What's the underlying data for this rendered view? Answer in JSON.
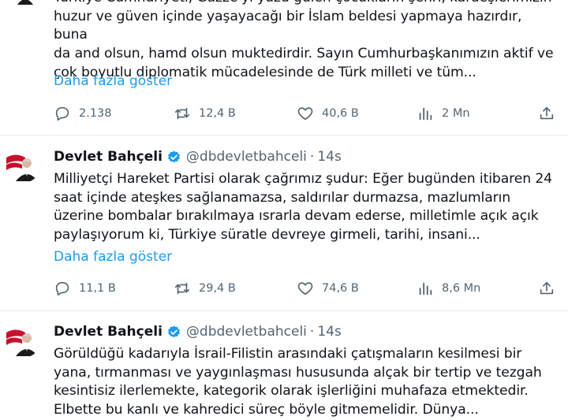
{
  "tweets": [
    {
      "text": "Türkiye Cumhuriyeti, Gazze'yi yüzü gülen çocukların şehri, kardeşlerimizin\nhuzur ve güven içinde yaşayacağı bir İslam beldesi yapmaya hazırdır, buna\nda and olsun, hamd olsun muktedirdir. Sayın Cumhurbaşkanımızın aktif ve\nçok boyutlu diplomatik mücadelesinde de Türk milleti ve tüm...",
      "more": "Daha fazla göster",
      "replies": "2.138",
      "retweets": "12,4 B",
      "likes": "40,6 B",
      "views": "2 Mn"
    },
    {
      "name": "Devlet Bahçeli",
      "handle": "@dbdevletbahceli",
      "dot": "·",
      "time": "14s",
      "text": "Milliyetçi Hareket Partisi olarak çağrımız şudur: Eğer bugünden itibaren 24\nsaat içinde ateşkes sağlanamazsa, saldırılar durmazsa, mazlumların\nüzerine bombalar bırakılmaya ısrarla devam ederse, milletimle açık açık\npaylaşıyorum ki, Türkiye süratle devreye girmeli, tarihi, insani...",
      "more": "Daha fazla göster",
      "replies": "11,1 B",
      "retweets": "29,4 B",
      "likes": "74,6 B",
      "views": "8,6 Mn"
    },
    {
      "name": "Devlet Bahçeli",
      "handle": "@dbdevletbahceli",
      "dot": "·",
      "time": "14s",
      "text": "Görüldüğü kadarıyla İsrail-Filistin arasındaki çatışmaların kesilmesi bir\nyana, tırmanması ve yaygınlaşması hususunda alçak bir tertip ve tezgah\nkesintisiz ilerlemekte, kategorik olarak işlerliğini muhafaza etmektedir.\nElbette bu kanlı ve kahredici süreç böyle gitmemelidir. Dünya..."
    }
  ],
  "icons": {
    "reply": "reply-icon",
    "retweet": "retweet-icon",
    "like": "heart-icon",
    "views": "views-icon",
    "share": "share-icon",
    "verified": "verified-badge-icon"
  },
  "colors": {
    "link": "#1d9bf0",
    "muted": "#536471",
    "text": "#0f1419",
    "avatar_red": "#c8102e"
  }
}
